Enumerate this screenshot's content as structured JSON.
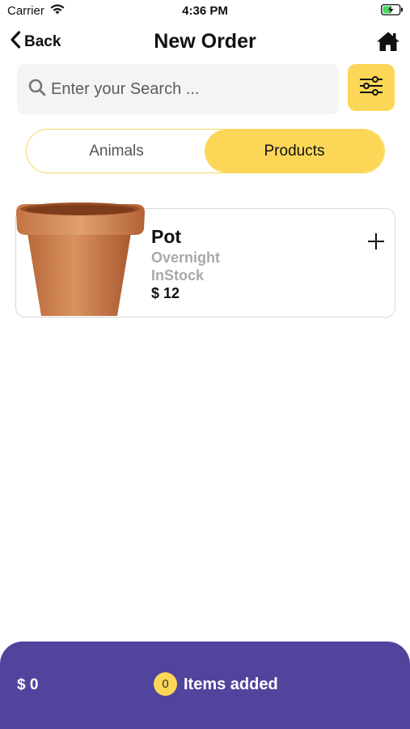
{
  "status_bar": {
    "carrier": "Carrier",
    "time": "4:36 PM",
    "icons": [
      "wifi-icon",
      "battery-charging-icon"
    ]
  },
  "nav": {
    "back_label": "Back",
    "title": "New Order",
    "icons": [
      "chevron-left-icon",
      "home-icon"
    ]
  },
  "search": {
    "placeholder": "Enter your Search ...",
    "value": "",
    "icons": [
      "search-icon",
      "filter-sliders-icon"
    ]
  },
  "tabs": [
    {
      "label": "Animals",
      "selected": false
    },
    {
      "label": "Products",
      "selected": true
    }
  ],
  "products": [
    {
      "name": "Pot",
      "shipping": "Overnight",
      "stock": "InStock",
      "price": "$ 12",
      "icons": [
        "clay-pot-image",
        "plus-icon"
      ]
    }
  ],
  "cart": {
    "total": "$ 0",
    "count": "0",
    "label": "Items added"
  },
  "colors": {
    "accent_yellow": "#fcd757",
    "bottom_bar_purple": "#51449d",
    "muted_text": "#a9a9a9"
  }
}
